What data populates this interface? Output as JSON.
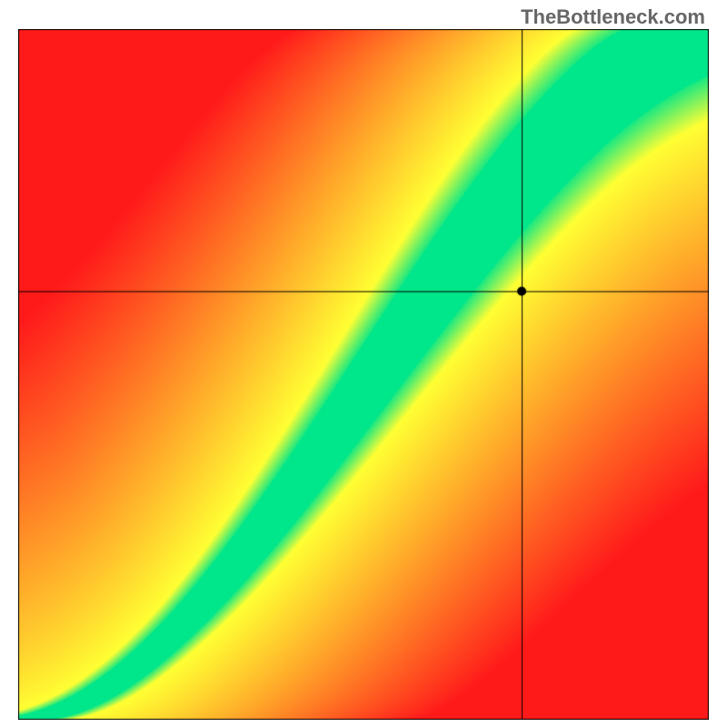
{
  "watermark": "TheBottleneck.com",
  "chart_data": {
    "type": "heatmap",
    "title": "",
    "xlabel": "",
    "ylabel": "",
    "xlim": [
      0,
      1
    ],
    "ylim": [
      0,
      1
    ],
    "crosshair": {
      "x": 0.73,
      "y": 0.62
    },
    "marker": {
      "x": 0.73,
      "y": 0.62
    },
    "colorscale": {
      "low": "#ff1a1a",
      "mid": "#ffff33",
      "high": "#00e68a"
    },
    "optimal_curve_description": "Green diagonal band from bottom-left to upper-right with slight S-curve; width narrows toward bottom-left and widens toward upper-right. Background gradient from red (far from curve) through yellow to green (on curve)."
  }
}
